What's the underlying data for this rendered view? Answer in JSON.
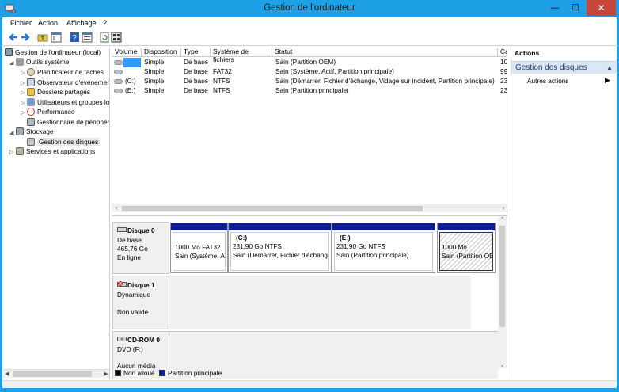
{
  "window": {
    "title": "Gestion de l'ordinateur",
    "min_glyph": "—",
    "max_glyph": "☐",
    "close_glyph": "✕"
  },
  "menu": [
    "Fichier",
    "Action",
    "Affichage",
    "?"
  ],
  "toolbar_icons": [
    "back-icon",
    "forward-icon",
    "up-folder-icon",
    "show-hide-tree-icon",
    "help-icon",
    "properties-icon",
    "refresh-icon",
    "export-icon"
  ],
  "tree": {
    "root": "Gestion de l'ordinateur (local)",
    "system_tools": "Outils système",
    "task_scheduler": "Planificateur de tâches",
    "event_viewer": "Observateur d'événements",
    "shared_folders": "Dossiers partagés",
    "local_users": "Utilisateurs et groupes locaux",
    "performance": "Performance",
    "device_manager": "Gestionnaire de périphériques",
    "storage": "Stockage",
    "disk_management": "Gestion des disques",
    "services": "Services et applications"
  },
  "volumes": {
    "columns": [
      "Volume",
      "Disposition",
      "Type",
      "Système de fichiers",
      "Statut",
      "Ca"
    ],
    "rows": [
      {
        "volume": "",
        "layout": "Simple",
        "type": "De base",
        "fs": "",
        "status": "Sain (Partition OEM)",
        "cap": "10"
      },
      {
        "volume": "",
        "layout": "Simple",
        "type": "De base",
        "fs": "FAT32",
        "status": "Sain (Système, Actif, Partition principale)",
        "cap": "99"
      },
      {
        "volume": "(C:)",
        "layout": "Simple",
        "type": "De base",
        "fs": "NTFS",
        "status": "Sain (Démarrer, Fichier d'échange, Vidage sur incident, Partition principale)",
        "cap": "23"
      },
      {
        "volume": "(E:)",
        "layout": "Simple",
        "type": "De base",
        "fs": "NTFS",
        "status": "Sain (Partition principale)",
        "cap": "23"
      }
    ]
  },
  "disks": {
    "disk0": {
      "name": "Disque 0",
      "kind": "De base",
      "size": "465,76 Go",
      "state": "En ligne",
      "partitions": [
        {
          "title": "",
          "size": "1000 Mo FAT32",
          "status": "Sain (Système, Actif, Partition principale)"
        },
        {
          "title": "(C:)",
          "size": "231,90 Go NTFS",
          "status": "Sain (Démarrer, Fichier d'échange, Vidage sur incident, Partition principale)"
        },
        {
          "title": "(E:)",
          "size": "231,90 Go NTFS",
          "status": "Sain (Partition principale)"
        },
        {
          "title": "",
          "size": "1000 Mo",
          "status": "Sain (Partition OEM)"
        }
      ]
    },
    "disk1": {
      "name": "Disque 1",
      "kind": "Dynamique",
      "state": "Non valide"
    },
    "cdrom0": {
      "name": "CD-ROM 0",
      "kind": "DVD (F:)",
      "state": "Aucun média"
    }
  },
  "legend": {
    "unallocated": "Non alloué",
    "primary": "Partition principale",
    "unallocated_color": "#000000",
    "primary_color": "#0a1e8c"
  },
  "actions": {
    "header": "Actions",
    "section": "Gestion des disques",
    "more": "Autres actions"
  },
  "colors": {
    "title_bar": "#1ea0e6",
    "close_button": "#c7463a",
    "selected_volume": "#3399ff",
    "actions_section": "#dce7f5"
  }
}
